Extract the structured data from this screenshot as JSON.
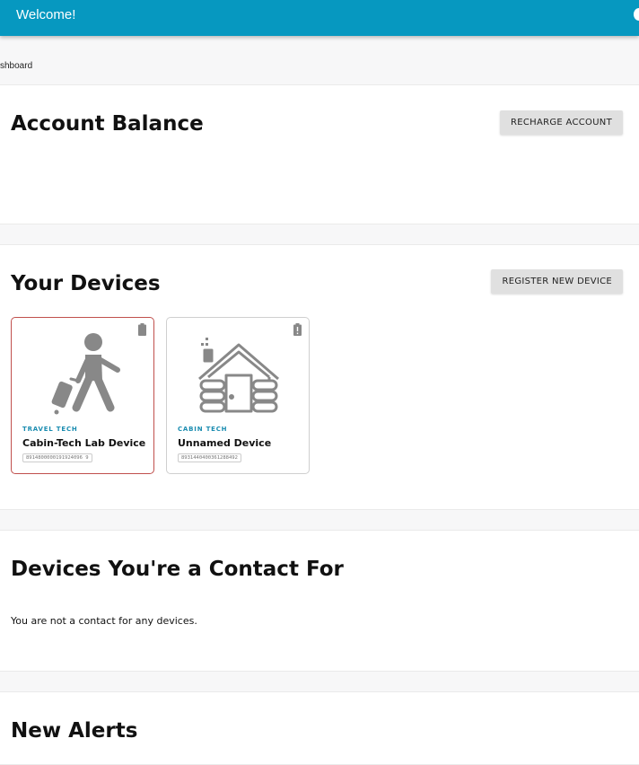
{
  "header": {
    "title": "Welcome!"
  },
  "breadcrumb": {
    "text": "shboard"
  },
  "account_balance": {
    "title": "Account Balance",
    "recharge_label": "RECHARGE ACCOUNT"
  },
  "devices": {
    "title": "Your Devices",
    "register_label": "REGISTER NEW DEVICE",
    "items": [
      {
        "category": "TRAVEL TECH",
        "name": "Cabin-Tech Lab Device",
        "serial": "8914800000191924096 9",
        "icon": "traveler-icon"
      },
      {
        "category": "CABIN TECH",
        "name": "Unnamed Device",
        "serial": "8931440400361288492",
        "icon": "cabin-icon"
      }
    ]
  },
  "contacts": {
    "title": "Devices You're a Contact For",
    "empty_text": "You are not a contact for any devices."
  },
  "alerts": {
    "title": "New Alerts"
  },
  "colors": {
    "header": "#0698c0",
    "accent": "#1a8cb0",
    "selected_border": "#c0504d"
  }
}
